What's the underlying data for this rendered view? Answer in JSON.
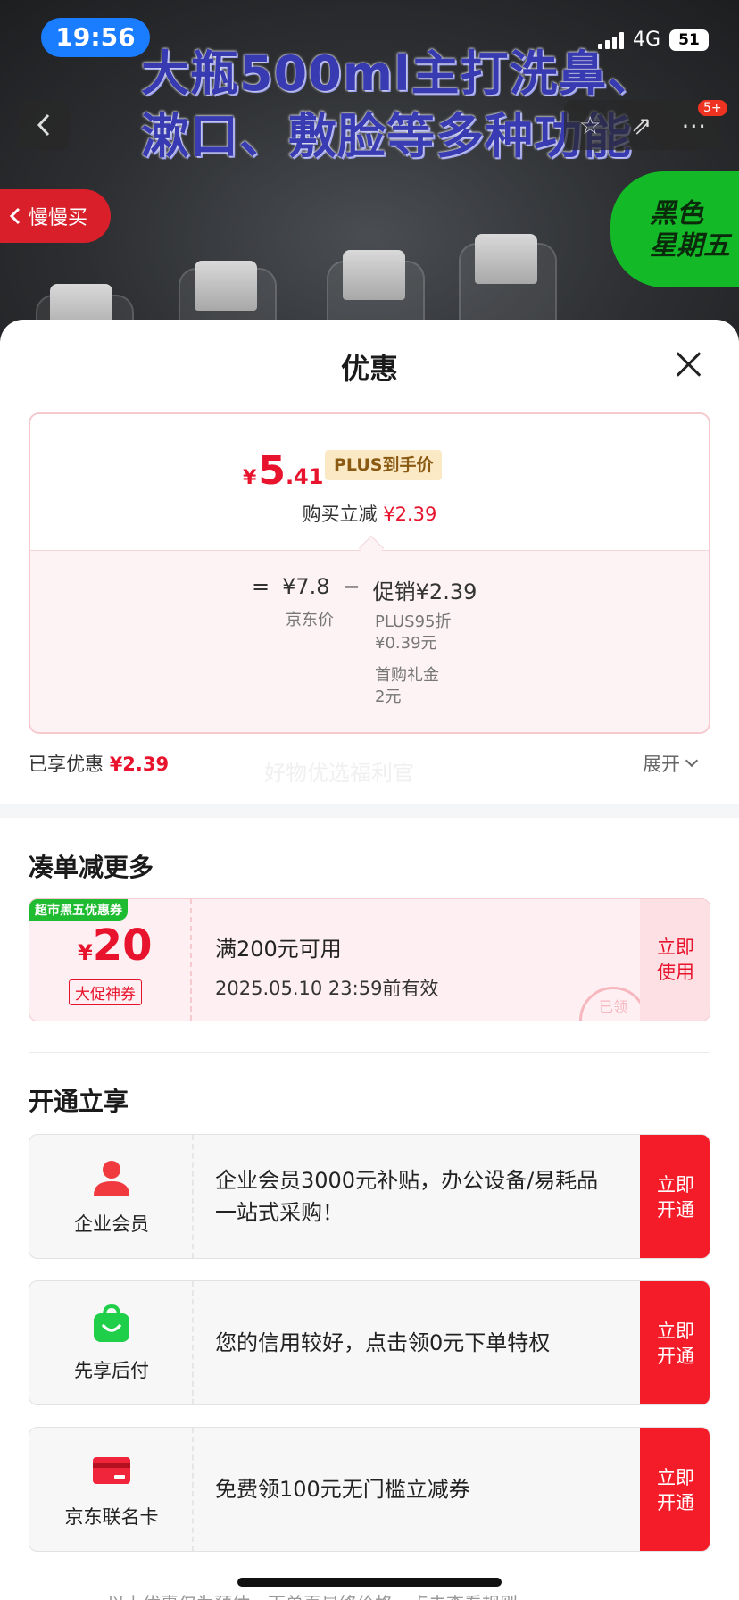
{
  "status": {
    "time": "19:56",
    "network": "4G",
    "battery": "51"
  },
  "hero": {
    "headline_line1": "大瓶500ml主打洗鼻、",
    "headline_line2": "漱口、敷脸等多种功能",
    "slow_buy": "慢慢买",
    "black_friday_line1": "黑色",
    "black_friday_line2": "星期五",
    "notif_badge": "5+",
    "icons": [
      "back-icon",
      "star-icon",
      "share-icon",
      "more-icon"
    ]
  },
  "sheet": {
    "title": "优惠",
    "price_card": {
      "currency": "¥",
      "price_int": "5",
      "price_dec": ".41",
      "plus_tag": "PLUS到手价",
      "reduce_label": "购买立减",
      "reduce_amount": "¥2.39",
      "eq": "=",
      "base_price": "¥7.8",
      "minus": "−",
      "promo": "促销¥2.39",
      "base_label": "京东价",
      "promo_item1_line1": "PLUS95折",
      "promo_item1_line2": "¥0.39元",
      "promo_item2_line1": "首购礼金",
      "promo_item2_line2": "2元"
    },
    "enjoyed_label": "已享优惠",
    "enjoyed_amount": "¥2.39",
    "watermark": "好物优选福利官",
    "expand": "展开"
  },
  "bundle": {
    "title": "凑单减更多",
    "coupon": {
      "tag": "超市黑五优惠券",
      "currency": "¥",
      "amount": "20",
      "sub": "大促神券",
      "condition": "满200元可用",
      "expiry": "2025.05.10 23:59前有效",
      "stamp": "已领",
      "btn_line1": "立即",
      "btn_line2": "使用"
    }
  },
  "open": {
    "title": "开通立享",
    "items": [
      {
        "name": "企业会员",
        "desc": "企业会员3000元补贴，办公设备/易耗品一站式采购！",
        "btn_line1": "立即",
        "btn_line2": "开通",
        "icon": "user-icon"
      },
      {
        "name": "先享后付",
        "desc": "您的信用较好，点击领0元下单特权",
        "btn_line1": "立即",
        "btn_line2": "开通",
        "icon": "shopping-bag-icon"
      },
      {
        "name": "京东联名卡",
        "desc": "免费领100元无门槛立减券",
        "btn_line1": "立即",
        "btn_line2": "开通",
        "icon": "credit-card-icon"
      }
    ]
  },
  "footer_peek": "以上优惠仅为预估，下单页最终价格，点击查看规则",
  "colors": {
    "accent": "#e8132c",
    "button_red": "#f51c2a",
    "green": "#1fbb31",
    "status_blue": "#1a7cff"
  }
}
